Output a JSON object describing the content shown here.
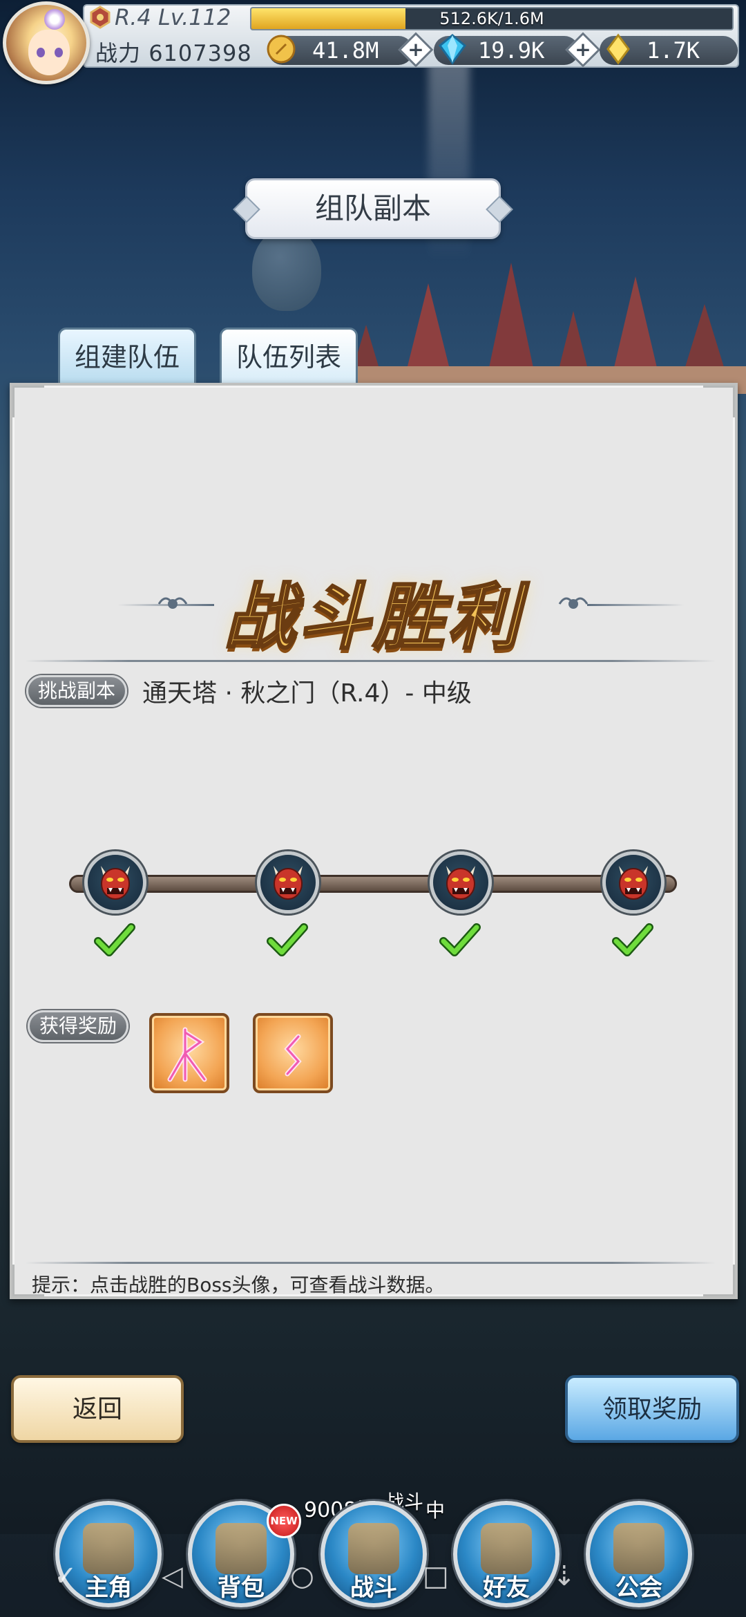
{
  "player": {
    "rank": "R.4 Lv.112",
    "xp_text": "512.6K/1.6M",
    "xp_fraction": 0.32,
    "power_label": "战力",
    "power_value": "6107398"
  },
  "resources": [
    {
      "icon": "gold-coin-icon",
      "value": "41.8M"
    },
    {
      "icon": "blue-gem-icon",
      "value": "19.9K"
    },
    {
      "icon": "yellow-crystal-icon",
      "value": "1.7K"
    }
  ],
  "title": "组队副本",
  "tabs": [
    {
      "label": "组建队伍"
    },
    {
      "label": "队伍列表"
    }
  ],
  "victory_text": "战斗胜利",
  "challenge": {
    "label": "挑战副本",
    "value": "通天塔 · 秋之门（R.4）- 中级"
  },
  "bosses": [
    {
      "icon": "demon-boss-icon",
      "defeated": true
    },
    {
      "icon": "demon-boss-icon",
      "defeated": true
    },
    {
      "icon": "demon-boss-icon",
      "defeated": true
    },
    {
      "icon": "demon-boss-icon",
      "defeated": true
    }
  ],
  "rewards": {
    "label": "获得奖励",
    "items": [
      {
        "icon": "rune-perthro-icon"
      },
      {
        "icon": "rune-sowilo-icon"
      }
    ]
  },
  "hint": "提示：点击战胜的Boss头像，可查看战斗数据。",
  "buttons": {
    "back": "返回",
    "claim": "领取奖励"
  },
  "battle_status": {
    "floor": "9008层",
    "state_a": "战斗",
    "state_b": "中"
  },
  "nav": [
    {
      "label": "主角",
      "icon": "hero-helmet-icon"
    },
    {
      "label": "背包",
      "icon": "backpack-icon",
      "badge": "NEW"
    },
    {
      "label": "战斗",
      "icon": "crossed-swords-icon"
    },
    {
      "label": "好友",
      "icon": "handshake-icon"
    },
    {
      "label": "公会",
      "icon": "guild-crest-icon"
    }
  ],
  "system_nav": [
    "✓",
    "◁",
    "○",
    "□",
    "⇣"
  ],
  "colors": {
    "victory_gold": "#f3c257",
    "claim_blue": "#5aa7e4",
    "back_cream": "#efd6a4",
    "panel_gray": "#e7e7e7"
  }
}
